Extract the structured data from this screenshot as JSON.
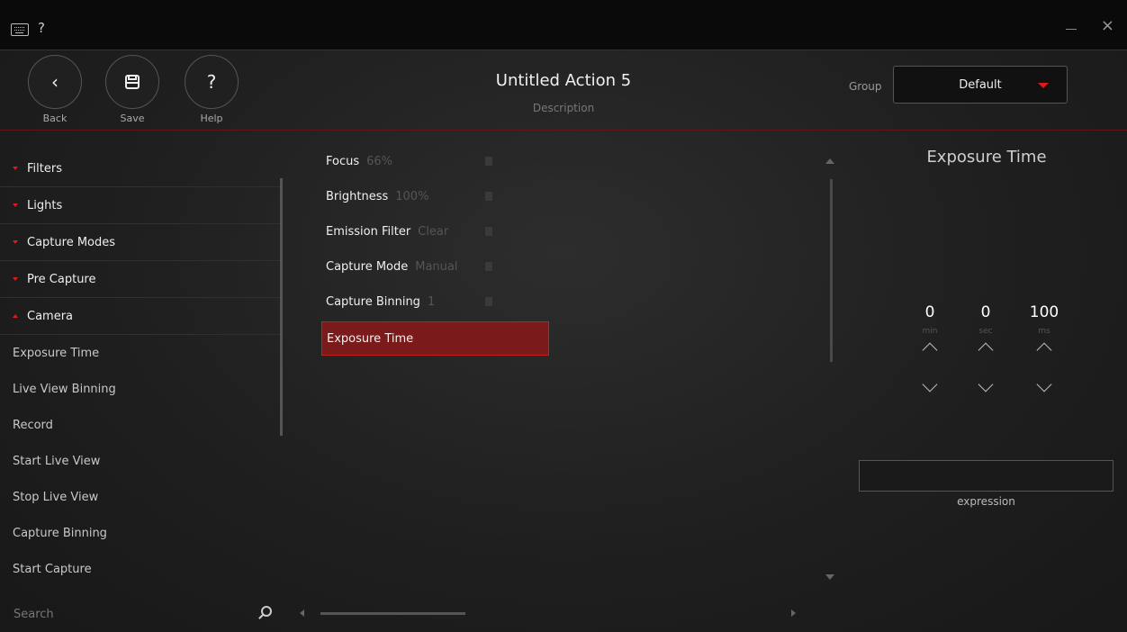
{
  "titlebar": {
    "help": "?",
    "close": "×"
  },
  "header": {
    "back_label": "Back",
    "save_label": "Save",
    "help_label": "Help",
    "title": "Untitled Action 5",
    "description_placeholder": "Description",
    "group_label": "Group",
    "group_value": "Default"
  },
  "sidebar": {
    "categories": [
      "Filters",
      "Lights",
      "Capture Modes",
      "Pre Capture",
      "Camera"
    ],
    "items": [
      "Exposure Time",
      "Live View Binning",
      "Record",
      "Start Live View",
      "Stop Live View",
      "Capture Binning",
      "Start Capture"
    ],
    "search_placeholder": "Search"
  },
  "steps": [
    {
      "name": "Focus",
      "value": "66%"
    },
    {
      "name": "Brightness",
      "value": "100%"
    },
    {
      "name": "Emission Filter",
      "value": "Clear"
    },
    {
      "name": "Capture Mode",
      "value": "Manual"
    },
    {
      "name": "Capture Binning",
      "value": "1"
    },
    {
      "name": "Exposure Time",
      "value": ""
    }
  ],
  "panel": {
    "title": "Exposure Time",
    "min_value": "0",
    "min_unit": "min",
    "sec_value": "0",
    "sec_unit": "sec",
    "ms_value": "100",
    "ms_unit": "ms",
    "expression_label": "expression"
  },
  "colors": {
    "accent": "#e01818",
    "selected": "#7a1a1a"
  }
}
